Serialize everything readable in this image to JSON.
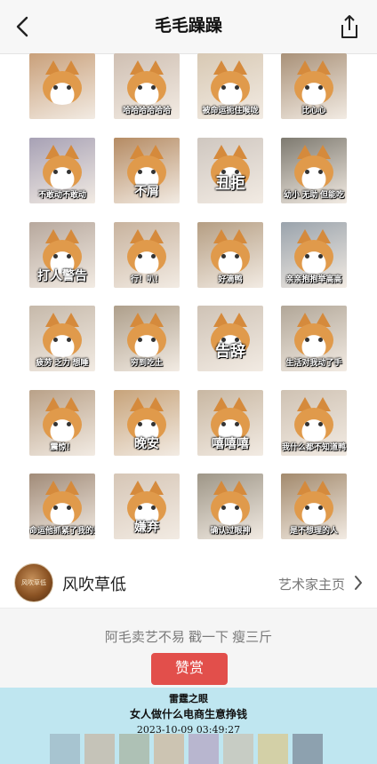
{
  "header": {
    "title": "毛毛躁躁",
    "back_icon": "chevron-left-icon",
    "share_icon": "share-icon"
  },
  "stickers": [
    {
      "caption": "",
      "bg": "#c9a07a",
      "style": "normal"
    },
    {
      "caption": "哈哈哈哈哈哈",
      "bg": "#cfbfb2",
      "style": "normal"
    },
    {
      "caption": "被命运扼住喉咙",
      "bg": "#d8c9b4",
      "style": "normal"
    },
    {
      "caption": "比心心",
      "bg": "#a99178",
      "style": "normal"
    },
    {
      "caption": "不敢动不敢动",
      "bg": "#a7a1b5",
      "style": "normal"
    },
    {
      "caption": "不屑",
      "bg": "#b58b63",
      "style": "big"
    },
    {
      "caption": "丑拒",
      "bg": "#cfc7c0",
      "style": "huge"
    },
    {
      "caption": "幼小 无助 但能吃",
      "bg": "#7e7a70",
      "style": "normal"
    },
    {
      "caption": "打人警告",
      "bg": "#b7a89d",
      "style": "big"
    },
    {
      "caption": "行！叭！",
      "bg": "#c8b39e",
      "style": "normal"
    },
    {
      "caption": "好滴鸭",
      "bg": "#b59e83",
      "style": "normal"
    },
    {
      "caption": "亲亲抱抱举高高",
      "bg": "#9aa3ac",
      "style": "normal"
    },
    {
      "caption": "疲劳 乏力 想睡",
      "bg": "#c6b9aa",
      "style": "normal"
    },
    {
      "caption": "穷到吃土",
      "bg": "#ae9f8b",
      "style": "normal"
    },
    {
      "caption": "告辞",
      "bg": "#cfc3b6",
      "style": "huge"
    },
    {
      "caption": "生活对我动了手",
      "bg": "#b2a798",
      "style": "normal"
    },
    {
      "caption": "震惊！",
      "bg": "#b9a188",
      "style": "normal"
    },
    {
      "caption": "晚安",
      "bg": "#c7a37a",
      "style": "big"
    },
    {
      "caption": "嘻嘻嘻",
      "bg": "#c8b7a2",
      "style": "big"
    },
    {
      "caption": "我什么都不知道鸭",
      "bg": "#cfc2b3",
      "style": "normal"
    },
    {
      "caption": "命运他抓紧了我的头皮",
      "bg": "#a18b78",
      "style": "normal"
    },
    {
      "caption": "嫌弃",
      "bg": "#d6c6b6",
      "style": "big"
    },
    {
      "caption": "确认过眼神",
      "bg": "#9e9687",
      "style": "normal"
    },
    {
      "caption": "是不想理的人",
      "bg": "#a38a6d",
      "style": "normal"
    }
  ],
  "artist": {
    "avatar_text": "风吹草低",
    "name": "风吹草低",
    "home_label": "艺术家主页"
  },
  "tip": {
    "text": "阿毛卖艺不易 戳一下 瘦三斤",
    "button_label": "赞赏"
  },
  "watermark": {
    "line1": "雷霆之眼",
    "line2": "女人做什么电商生意挣钱",
    "line3": "2023-10-09 03:49:27"
  },
  "colors": {
    "accent": "#e24f4b",
    "overlay": "#bfe6f0",
    "topbar": "#f7f7f7"
  }
}
